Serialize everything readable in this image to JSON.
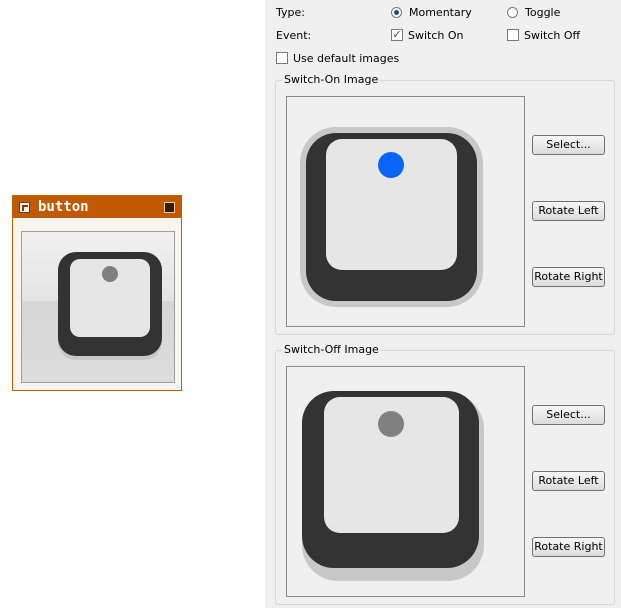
{
  "widget": {
    "title": "button",
    "icon": "widget-icon",
    "pin_icon": "pin-icon"
  },
  "options": {
    "type_label": "Type:",
    "type_options": [
      {
        "label": "Momentary",
        "selected": true
      },
      {
        "label": "Toggle",
        "selected": false
      }
    ],
    "event_label": "Event:",
    "event_options": [
      {
        "label": "Switch On",
        "checked": true
      },
      {
        "label": "Switch Off",
        "checked": false
      }
    ],
    "default_images_label": "Use default images",
    "default_images_checked": false
  },
  "switch_on": {
    "group_title": "Switch-On Image",
    "dot_color": "#0a64f5",
    "select_label": "Select...",
    "rotate_left_label": "Rotate Left",
    "rotate_right_label": "Rotate Right"
  },
  "switch_off": {
    "group_title": "Switch-Off Image",
    "dot_color": "#808080",
    "select_label": "Select...",
    "rotate_left_label": "Rotate Left",
    "rotate_right_label": "Rotate Right"
  },
  "check_glyph": "✓"
}
